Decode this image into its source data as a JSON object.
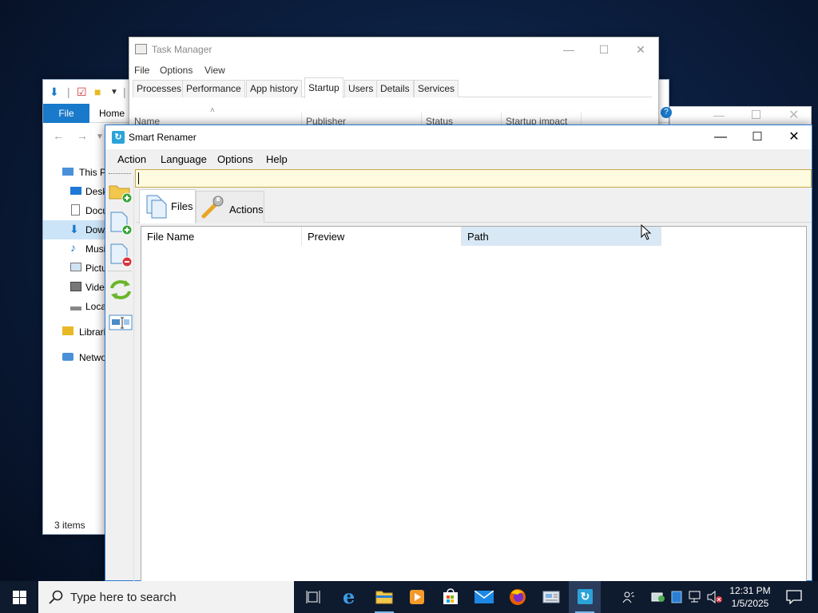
{
  "explorer": {
    "tab_file": "File",
    "tab_home": "Home",
    "tree": [
      {
        "label": "This P",
        "icon": "computer-icon"
      },
      {
        "label": "Desk",
        "icon": "desktop-icon"
      },
      {
        "label": "Docu",
        "icon": "document-icon"
      },
      {
        "label": "Dow",
        "icon": "download-icon",
        "selected": true
      },
      {
        "label": "Musi",
        "icon": "music-icon"
      },
      {
        "label": "Pictu",
        "icon": "pictures-icon"
      },
      {
        "label": "Vide",
        "icon": "video-icon"
      },
      {
        "label": "Loca",
        "icon": "drive-icon"
      },
      {
        "label": "Librari",
        "icon": "library-icon"
      },
      {
        "label": "Netwo",
        "icon": "network-icon"
      }
    ],
    "status": "3 items"
  },
  "taskmgr": {
    "title": "Task Manager",
    "menu": [
      "File",
      "Options",
      "View"
    ],
    "tabs": [
      "Processes",
      "Performance",
      "App history",
      "Startup",
      "Users",
      "Details",
      "Services"
    ],
    "active_tab": "Startup",
    "columns": [
      "Name",
      "Publisher",
      "Status",
      "Startup impact"
    ]
  },
  "renamer": {
    "title": "Smart Renamer",
    "menu": [
      "Action",
      "Language",
      "Options",
      "Help"
    ],
    "path_value": "",
    "tabs": [
      {
        "label": "Files",
        "icon": "files-icon"
      },
      {
        "label": "Actions",
        "icon": "wrench-icon"
      }
    ],
    "columns": [
      "File Name",
      "Preview",
      "Path"
    ],
    "sidebar_buttons": [
      "add-folder-icon",
      "add-file-icon",
      "remove-file-icon",
      "refresh-icon",
      "rename-icon"
    ]
  },
  "taskbar": {
    "search_placeholder": "Type here to search",
    "time": "12:31 PM",
    "date": "1/5/2025",
    "apps": [
      "task-view-icon",
      "edge-icon",
      "file-explorer-icon",
      "media-player-icon",
      "store-icon",
      "mail-icon",
      "firefox-icon",
      "control-panel-icon",
      "smart-renamer-icon"
    ]
  },
  "colors": {
    "accent": "#1979ca",
    "taskbar": "#0e1a2e",
    "path_box": "#fffbe0",
    "path_col_highlight": "#d9e8f5"
  }
}
